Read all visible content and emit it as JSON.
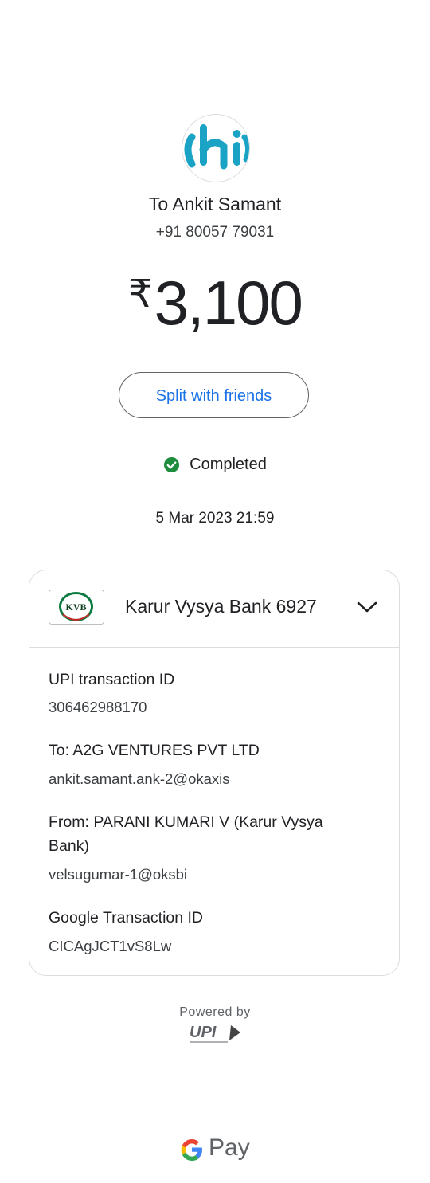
{
  "recipient": {
    "avatar_text": "hi",
    "name": "To Ankit Samant",
    "phone": "+91 80057 79031"
  },
  "payment": {
    "currency_symbol": "₹",
    "amount": "3,100"
  },
  "actions": {
    "split_label": "Split with friends"
  },
  "status": {
    "text": "Completed",
    "color": "#1e8e3e",
    "date": "5 Mar 2023 21:59"
  },
  "bank": {
    "logo_text": "KVB",
    "name": "Karur Vysya Bank 6927"
  },
  "details": [
    {
      "label": "UPI transaction ID",
      "value": "306462988170"
    },
    {
      "label": "To: A2G VENTURES PVT LTD",
      "value": "ankit.samant.ank-2@okaxis"
    },
    {
      "label": "From: PARANI KUMARI V (Karur Vysya Bank)",
      "value": "velsugumar-1@oksbi"
    },
    {
      "label": "Google Transaction ID",
      "value": "CICAgJCT1vS8Lw"
    }
  ],
  "footer": {
    "powered_by": "Powered by",
    "upi_logo_text": "UPI",
    "gpay_text": "Pay"
  },
  "colors": {
    "accent": "#1a73e8",
    "kvb_green": "#0b7a3e"
  }
}
